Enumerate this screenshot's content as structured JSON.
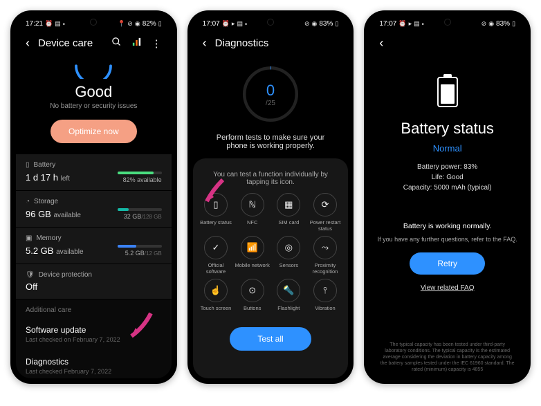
{
  "screen1": {
    "status": {
      "time": "17:21",
      "battery": "82%"
    },
    "header": {
      "title": "Device care"
    },
    "good": {
      "title": "Good",
      "subtitle": "No battery or security issues"
    },
    "optimize": "Optimize now",
    "battery": {
      "label": "Battery",
      "value": "1 d 17 h",
      "suffix": "left",
      "pct": "82% available",
      "fill": 82,
      "color": "#4ade80"
    },
    "storage": {
      "label": "Storage",
      "value": "96 GB",
      "suffix": "available",
      "right": "32 GB",
      "total": "/128 GB",
      "fill": 25,
      "color": "#14b8a6"
    },
    "memory": {
      "label": "Memory",
      "value": "5.2 GB",
      "suffix": "available",
      "right": "5.2 GB",
      "total": "/12 GB",
      "fill": 43,
      "color": "#3b82f6"
    },
    "protection": {
      "label": "Device protection",
      "value": "Off"
    },
    "additional": "Additional care",
    "software": {
      "title": "Software update",
      "sub": "Last checked on February 7, 2022"
    },
    "diagnostics": {
      "title": "Diagnostics",
      "sub": "Last checked February 7, 2022"
    }
  },
  "screen2": {
    "status": {
      "time": "17:07",
      "battery": "83%"
    },
    "header": {
      "title": "Diagnostics"
    },
    "ring": {
      "current": "0",
      "total": "/25"
    },
    "text": "Perform tests to make sure your phone is working properly.",
    "subtext": "You can test a function individually by tapping its icon.",
    "items": [
      {
        "icon": "battery",
        "label": "Battery status"
      },
      {
        "icon": "nfc",
        "label": "NFC"
      },
      {
        "icon": "sim",
        "label": "SIM card"
      },
      {
        "icon": "power",
        "label": "Power restart status"
      },
      {
        "icon": "sw",
        "label": "Official software"
      },
      {
        "icon": "mobile",
        "label": "Mobile network"
      },
      {
        "icon": "sensors",
        "label": "Sensors"
      },
      {
        "icon": "prox",
        "label": "Proximity recognition"
      },
      {
        "icon": "touch",
        "label": "Touch screen"
      },
      {
        "icon": "buttons",
        "label": "Buttons"
      },
      {
        "icon": "flash",
        "label": "Flashlight"
      },
      {
        "icon": "vib",
        "label": "Vibration"
      }
    ],
    "testall": "Test all"
  },
  "screen3": {
    "status": {
      "time": "17:07",
      "battery": "83%"
    },
    "title": "Battery status",
    "status_label": "Normal",
    "power": "Battery power: 83%",
    "life": "Life: Good",
    "capacity": "Capacity: 5000 mAh (typical)",
    "normal": "Battery is working normally.",
    "faq_hint": "If you have any further questions, refer to the FAQ.",
    "retry": "Retry",
    "faq_link": "View related FAQ",
    "disclaimer": "The typical capacity has been tested under third-party laboratory conditions. The typical capacity is the estimated average considering the deviation in battery capacity among the battery samples tested under the IEC 61960 standard. The rated (minimum) capacity is 4855",
    "fill_pct": 83
  }
}
